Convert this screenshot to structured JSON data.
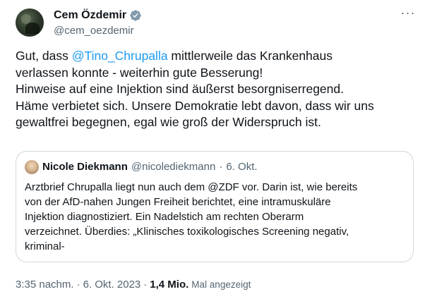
{
  "author": {
    "name": "Cem Özdemir",
    "handle": "@cem_oezdemir",
    "verified": true,
    "badge_color": "#829aab"
  },
  "more_label": "···",
  "tweet": {
    "lines": [
      {
        "before": "Gut, dass ",
        "mention": "@Tino_Chrupalla",
        "after": " mittlerweile das Krankenhaus"
      },
      "verlassen konnte - weiterhin gute Besserung!",
      "Hinweise auf eine Injektion sind äußerst besorgniserregend.",
      "Häme verbietet sich. Unsere Demokratie lebt davon, dass wir uns",
      "gewaltfrei begegnen, egal wie groß der Widerspruch ist."
    ]
  },
  "quote": {
    "name": "Nicole Diekmann",
    "handle": "@nicolediekmann",
    "separator": "·",
    "date": "6. Okt.",
    "lines": [
      "Arztbrief Chrupalla liegt nun auch dem @ZDF vor. Darin ist, wie bereits",
      "von der AfD-nahen Jungen Freiheit berichtet, eine intramuskuläre",
      "Injektion diagnostiziert. Ein Nadelstich am rechten Oberarm",
      "verzeichnet. Überdies: „Klinisches toxikologisches Screening negativ,",
      "kriminal-"
    ]
  },
  "meta": {
    "time": "3:35 nachm.",
    "sep1": "·",
    "date": "6. Okt. 2023",
    "sep2": "·",
    "views_count": "1,4 Mio.",
    "views_label": "Mal angezeigt"
  },
  "colors": {
    "link": "#1d9bf0",
    "secondary_text": "#536471",
    "border": "#cfd9de"
  }
}
